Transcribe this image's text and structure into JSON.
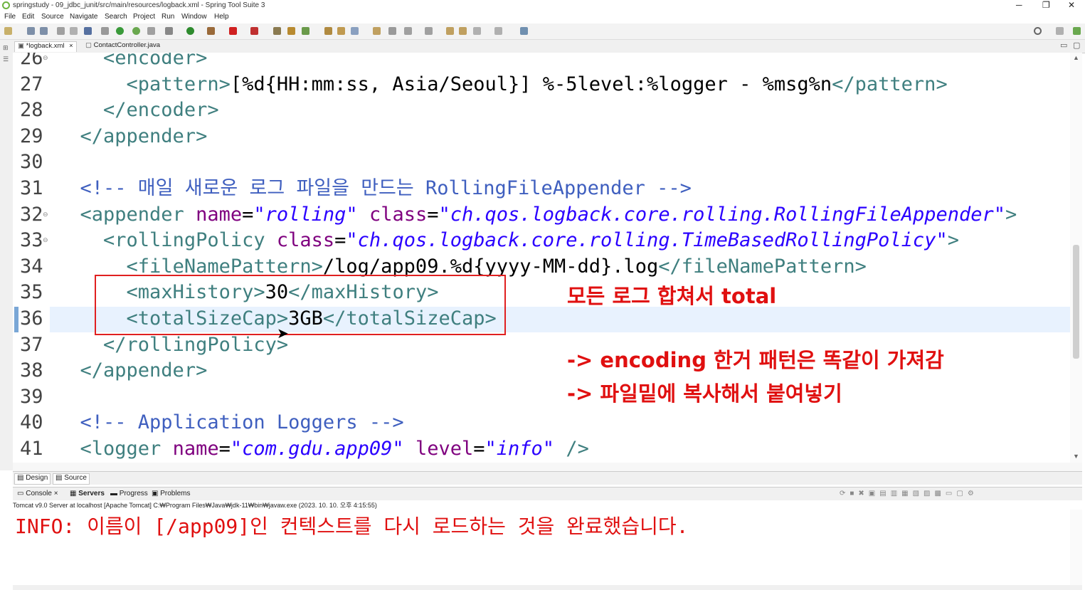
{
  "window": {
    "title": "springstudy - 09_jdbc_junit/src/main/resources/logback.xml - Spring Tool Suite 3",
    "min_glyph": "─",
    "max_glyph": "❐",
    "close_glyph": "✕"
  },
  "menu": [
    "File",
    "Edit",
    "Source",
    "Navigate",
    "Search",
    "Project",
    "Run",
    "Window",
    "Help"
  ],
  "editor_tabs": [
    {
      "label": "*logback.xml",
      "close": "×",
      "active": true
    },
    {
      "label": "ContactController.java",
      "close": "",
      "active": false
    }
  ],
  "code_lines": [
    {
      "num": "26",
      "fold": "⊖",
      "parts": [
        {
          "t": "    "
        },
        {
          "t": "<encoder>",
          "c": "tag"
        }
      ]
    },
    {
      "num": "27",
      "parts": [
        {
          "t": "      "
        },
        {
          "t": "<pattern>",
          "c": "tag"
        },
        {
          "t": "[%d{HH:mm:ss, Asia/Seoul}] %-5level:%logger - %msg%n"
        },
        {
          "t": "</pattern>",
          "c": "tag"
        }
      ]
    },
    {
      "num": "28",
      "parts": [
        {
          "t": "    "
        },
        {
          "t": "</encoder>",
          "c": "tag"
        }
      ]
    },
    {
      "num": "29",
      "parts": [
        {
          "t": "  "
        },
        {
          "t": "</appender>",
          "c": "tag"
        }
      ]
    },
    {
      "num": "30",
      "parts": []
    },
    {
      "num": "31",
      "parts": [
        {
          "t": "  "
        },
        {
          "t": "<!-- 매일 새로운 로그 파일을 만드는 RollingFileAppender -->",
          "c": "cmt"
        }
      ]
    },
    {
      "num": "32",
      "fold": "⊖",
      "parts": [
        {
          "t": "  "
        },
        {
          "t": "<appender ",
          "c": "tag"
        },
        {
          "t": "name",
          "c": "attr"
        },
        {
          "t": "="
        },
        {
          "t": "\"rolling\"",
          "c": "val"
        },
        {
          "t": " "
        },
        {
          "t": "class",
          "c": "attr"
        },
        {
          "t": "="
        },
        {
          "t": "\"ch.qos.logback.core.rolling.RollingFileAppender\"",
          "c": "val"
        },
        {
          "t": ">",
          "c": "tag"
        }
      ]
    },
    {
      "num": "33",
      "fold": "⊖",
      "parts": [
        {
          "t": "    "
        },
        {
          "t": "<rollingPolicy ",
          "c": "tag"
        },
        {
          "t": "class",
          "c": "attr"
        },
        {
          "t": "="
        },
        {
          "t": "\"ch.qos.logback.core.rolling.TimeBasedRollingPolicy\"",
          "c": "val"
        },
        {
          "t": ">",
          "c": "tag"
        }
      ]
    },
    {
      "num": "34",
      "parts": [
        {
          "t": "      "
        },
        {
          "t": "<fileNamePattern>",
          "c": "tag"
        },
        {
          "t": "/log/app09.%d{yyyy-MM-dd}.log"
        },
        {
          "t": "</fileNamePattern>",
          "c": "tag"
        }
      ]
    },
    {
      "num": "35",
      "parts": [
        {
          "t": "      "
        },
        {
          "t": "<maxHistory>",
          "c": "tag"
        },
        {
          "t": "30"
        },
        {
          "t": "</maxHistory>",
          "c": "tag"
        }
      ]
    },
    {
      "num": "36",
      "parts": [
        {
          "t": "      "
        },
        {
          "t": "<totalSizeCap>",
          "c": "tag"
        },
        {
          "t": "3GB"
        },
        {
          "t": "</totalSizeCap>",
          "c": "tag"
        }
      ]
    },
    {
      "num": "37",
      "parts": [
        {
          "t": "    "
        },
        {
          "t": "</rollingPolicy>",
          "c": "tag"
        }
      ]
    },
    {
      "num": "38",
      "parts": [
        {
          "t": "  "
        },
        {
          "t": "</appender>",
          "c": "tag"
        }
      ]
    },
    {
      "num": "39",
      "parts": []
    },
    {
      "num": "40",
      "parts": [
        {
          "t": "  "
        },
        {
          "t": "<!-- Application Loggers -->",
          "c": "cmt"
        }
      ]
    },
    {
      "num": "41",
      "parts": [
        {
          "t": "  "
        },
        {
          "t": "<logger ",
          "c": "tag"
        },
        {
          "t": "name",
          "c": "attr"
        },
        {
          "t": "="
        },
        {
          "t": "\"com.gdu.app09\"",
          "c": "val"
        },
        {
          "t": " "
        },
        {
          "t": "level",
          "c": "attr"
        },
        {
          "t": "="
        },
        {
          "t": "\"info\"",
          "c": "val"
        },
        {
          "t": " />",
          "c": "tag"
        }
      ]
    }
  ],
  "annotations": {
    "note1": "모든 로그 합쳐서 total",
    "note2": "-> encoding 한거 패턴은 똑같이 가져감",
    "note3": "-> 파일밑에 복사해서 붙여넣기"
  },
  "bottom_tabs": {
    "design": "Design",
    "source": "Source"
  },
  "console_tabs": [
    {
      "label": "Console",
      "suffix": "×",
      "bold": false
    },
    {
      "label": "Servers",
      "bold": true
    },
    {
      "label": "Progress",
      "bold": false
    },
    {
      "label": "Problems",
      "bold": false
    }
  ],
  "console": {
    "header": "Tomcat v9.0 Server at localhost [Apache Tomcat] C:₩Program Files₩Java₩jdk-11₩bin₩javaw.exe  (2023. 10. 10. 오후 4:15:55)",
    "output": "INFO: 이름이 [/app09]인 컨텍스트를 다시 로드하는 것을 완료했습니다."
  },
  "colors": {
    "tag": "#3f7f7f",
    "attr": "#7f007f",
    "value": "#2a00ff",
    "comment": "#3f5fbf",
    "annotation": "#e01010"
  }
}
